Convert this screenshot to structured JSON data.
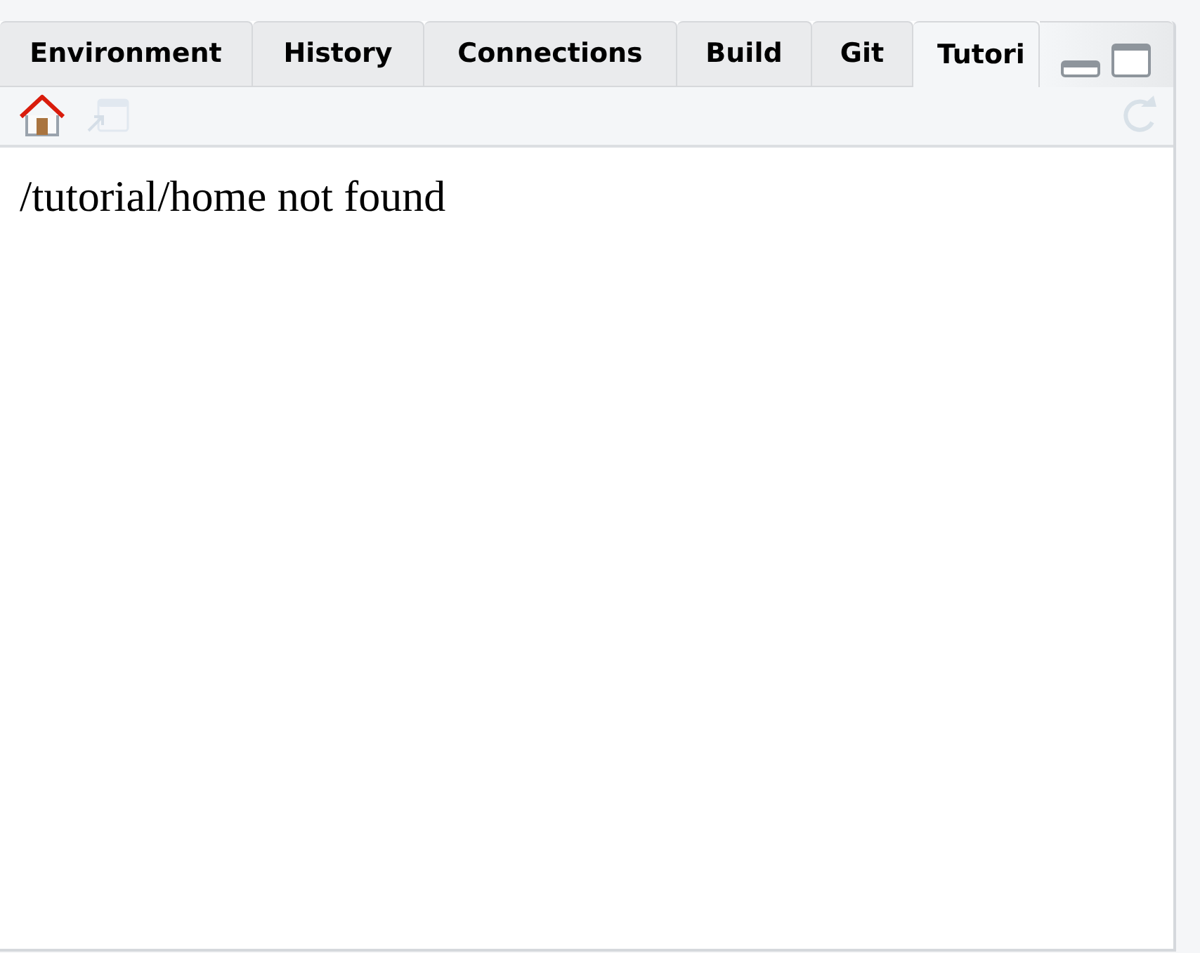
{
  "tabs": [
    {
      "label": "Environment",
      "selected": false
    },
    {
      "label": "History",
      "selected": false
    },
    {
      "label": "Connections",
      "selected": false
    },
    {
      "label": "Build",
      "selected": false
    },
    {
      "label": "Git",
      "selected": false
    },
    {
      "label": "Tutori",
      "selected": true
    }
  ],
  "toolbar": [
    {
      "kind": "home",
      "disabled": false
    },
    {
      "kind": "popout",
      "disabled": true
    },
    {
      "kind": "refresh",
      "disabled": true
    }
  ],
  "content": {
    "message": "/tutorial/home not found"
  }
}
